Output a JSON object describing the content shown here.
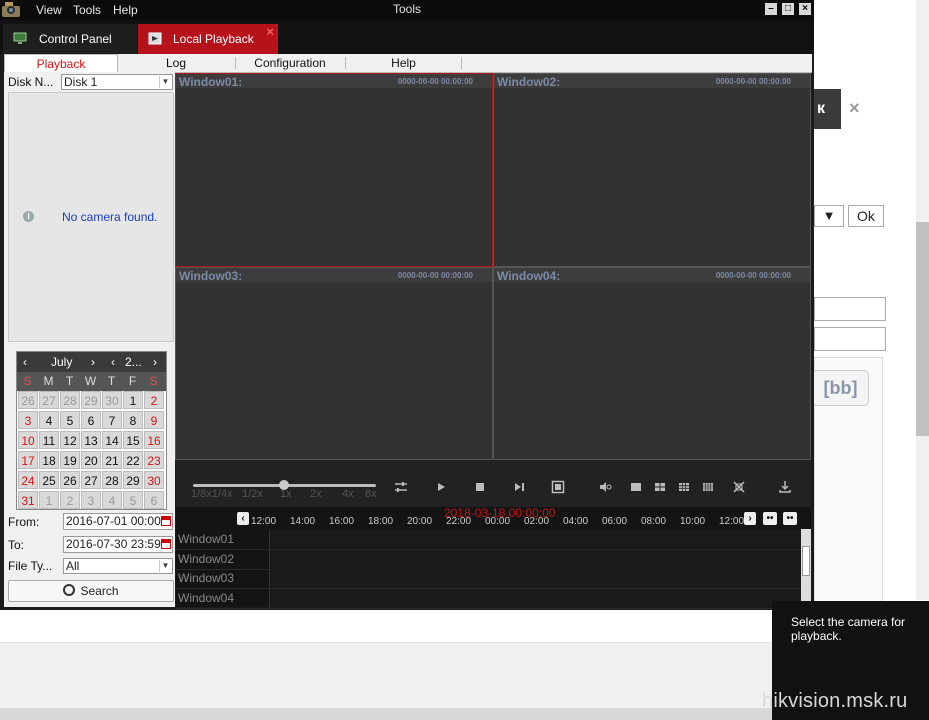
{
  "app": {
    "title": "Tools",
    "menu": [
      "View",
      "Tools",
      "Help"
    ],
    "tabs": [
      {
        "label": "Control Panel",
        "active": false
      },
      {
        "label": "Local Playback",
        "active": true
      }
    ],
    "subtabs": [
      "Playback",
      "Log",
      "Configuration",
      "Help"
    ]
  },
  "left_panel": {
    "disk_label": "Disk N...",
    "disk_value": "Disk 1",
    "no_camera_text": "No camera found.",
    "calendar": {
      "month": "July",
      "year": "2...",
      "weekdays": [
        "S",
        "M",
        "T",
        "W",
        "T",
        "F",
        "S"
      ],
      "weeks": [
        [
          "26",
          "27",
          "28",
          "29",
          "30",
          "1",
          "2"
        ],
        [
          "3",
          "4",
          "5",
          "6",
          "7",
          "8",
          "9"
        ],
        [
          "10",
          "11",
          "12",
          "13",
          "14",
          "15",
          "16"
        ],
        [
          "17",
          "18",
          "19",
          "20",
          "21",
          "22",
          "23"
        ],
        [
          "24",
          "25",
          "26",
          "27",
          "28",
          "29",
          "30"
        ],
        [
          "31",
          "1",
          "2",
          "3",
          "4",
          "5",
          "6"
        ]
      ]
    },
    "from_label": "From:",
    "from_value": "2016-07-01 00:00",
    "to_label": "To:",
    "to_value": "2016-07-30 23:59",
    "filetype_label": "File Ty...",
    "filetype_value": "All",
    "search_label": "Search"
  },
  "windows": [
    {
      "name": "Window01:",
      "time": "0000-00-00 00:00:00",
      "active": true
    },
    {
      "name": "Window02:",
      "time": "0000-00-00 00:00:00",
      "active": false
    },
    {
      "name": "Window03:",
      "time": "0000-00-00 00:00:00",
      "active": false
    },
    {
      "name": "Window04:",
      "time": "0000-00-00 00:00:00",
      "active": false
    }
  ],
  "speeds": [
    "1/8x1/4x",
    "1/2x",
    "1x",
    "2x",
    "4x",
    "8x"
  ],
  "timeline": {
    "current": "2018-03-18 00:00:00",
    "ticks": [
      "12:00",
      "14:00",
      "16:00",
      "18:00",
      "20:00",
      "22:00",
      "00:00",
      "02:00",
      "04:00",
      "06:00",
      "08:00",
      "10:00",
      "12:00"
    ],
    "rows": [
      "Window01",
      "Window02",
      "Window03",
      "Window04"
    ]
  },
  "background_page": {
    "dark_button_text": "к",
    "close_glyph": "×",
    "select_arrow": "▼",
    "ok_label": "Ok",
    "bb_label": "[bb]"
  },
  "tooltip": "Select the camera for playback.",
  "watermark": "hikvision.msk.ru",
  "colors": {
    "accent": "#b5121b",
    "link": "#1b3cc1",
    "window_label": "#7d8aa6"
  }
}
